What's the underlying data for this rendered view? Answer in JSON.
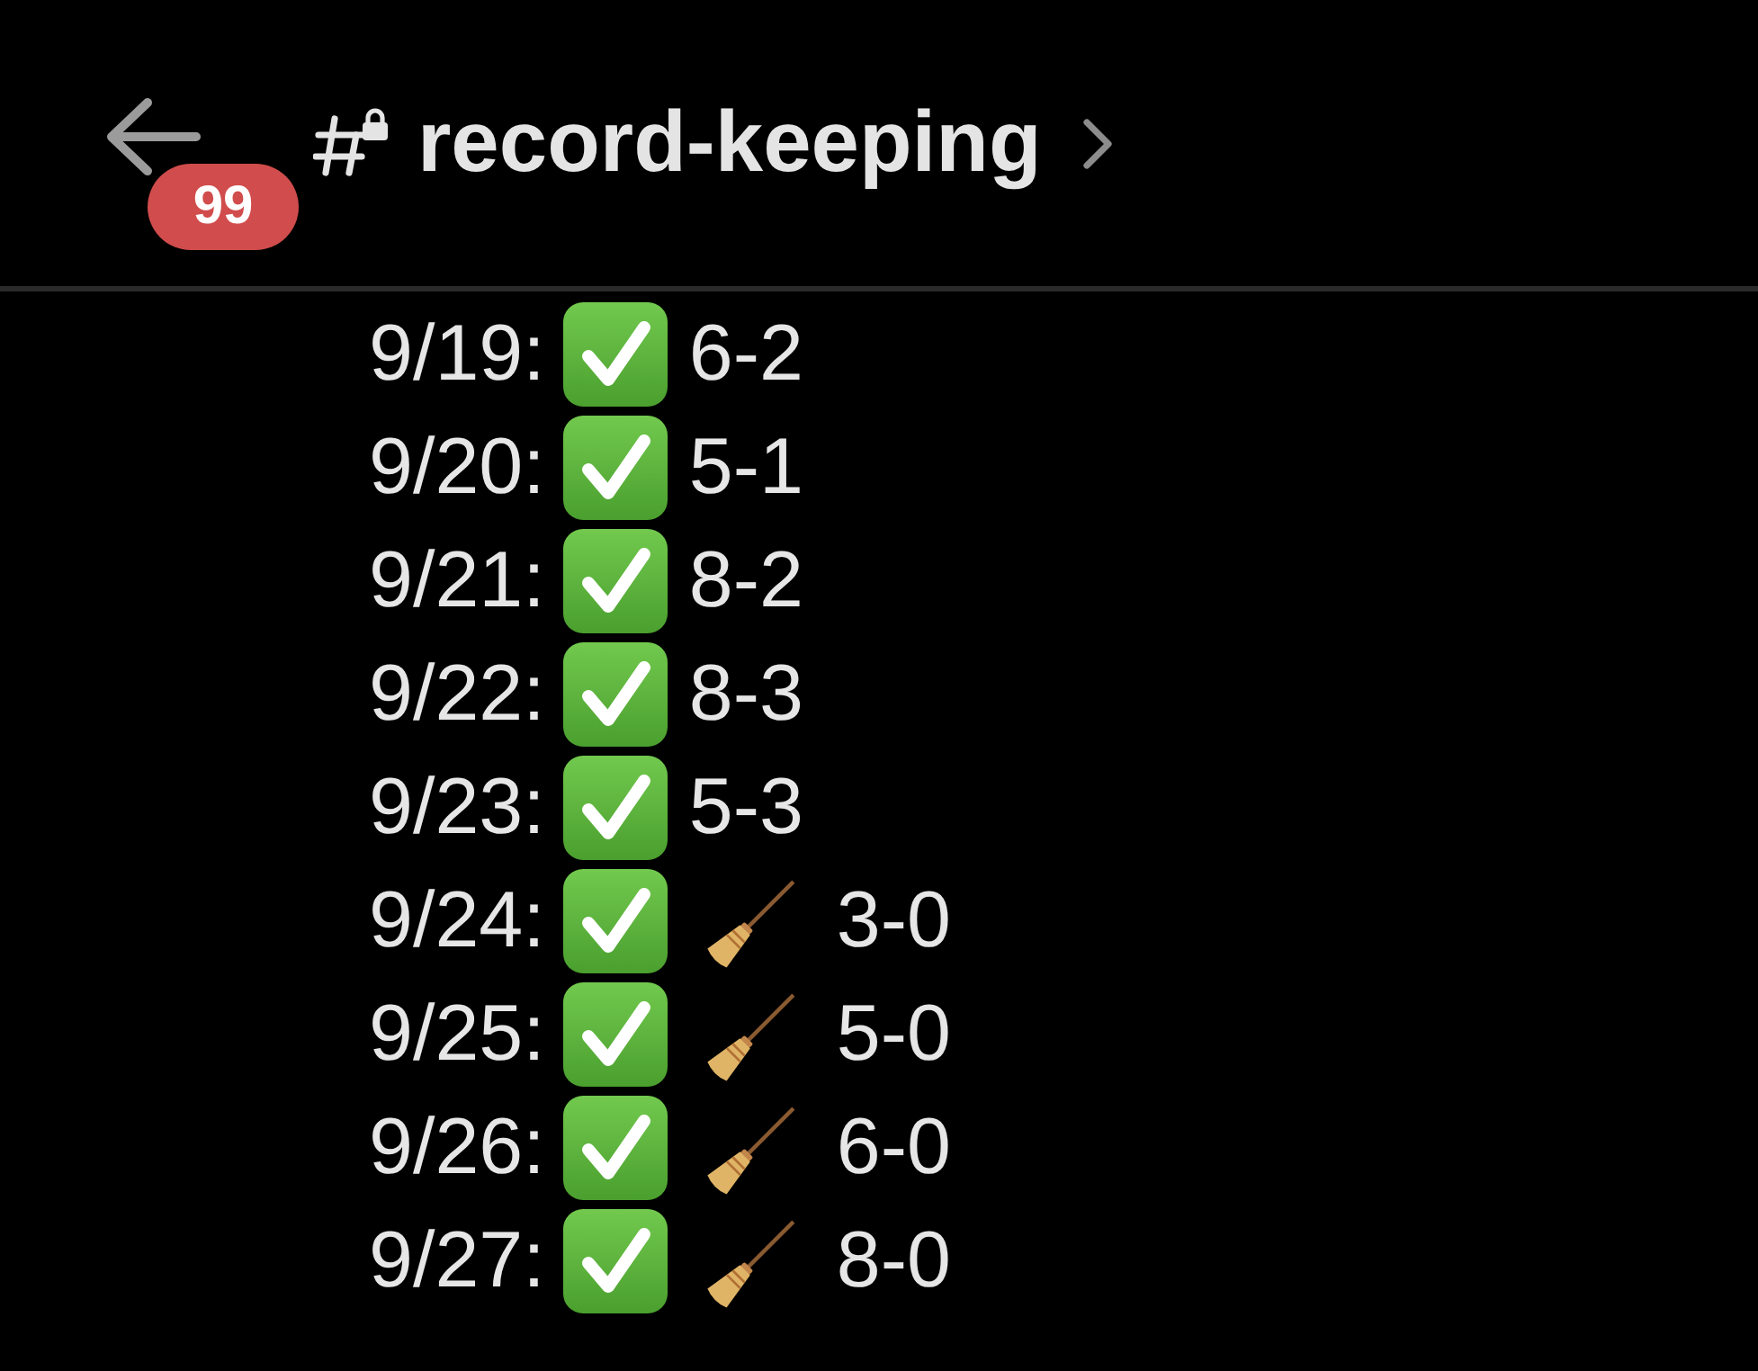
{
  "header": {
    "badge": "99",
    "channel": {
      "name": "record-keeping",
      "locked": true
    }
  },
  "messages": [
    {
      "date": "9/19:",
      "checked": true,
      "sweep": false,
      "score": "6-2"
    },
    {
      "date": "9/20:",
      "checked": true,
      "sweep": false,
      "score": "5-1"
    },
    {
      "date": "9/21:",
      "checked": true,
      "sweep": false,
      "score": "8-2"
    },
    {
      "date": "9/22:",
      "checked": true,
      "sweep": false,
      "score": "8-3"
    },
    {
      "date": "9/23:",
      "checked": true,
      "sweep": false,
      "score": "5-3"
    },
    {
      "date": "9/24:",
      "checked": true,
      "sweep": true,
      "score": "3-0"
    },
    {
      "date": "9/25:",
      "checked": true,
      "sweep": true,
      "score": "5-0"
    },
    {
      "date": "9/26:",
      "checked": true,
      "sweep": true,
      "score": "6-0"
    },
    {
      "date": "9/27:",
      "checked": true,
      "sweep": true,
      "score": "8-0"
    }
  ]
}
